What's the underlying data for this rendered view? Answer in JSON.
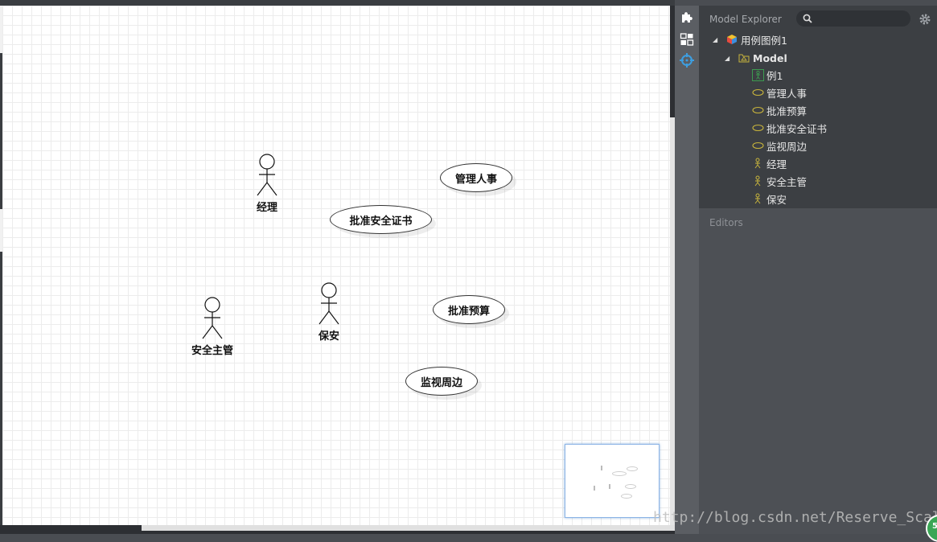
{
  "diagram": {
    "actors": [
      {
        "id": "actor-jingli",
        "label": "经理"
      },
      {
        "id": "actor-anquanzhuguan",
        "label": "安全主管"
      },
      {
        "id": "actor-baoan",
        "label": "保安"
      }
    ],
    "usecases": [
      {
        "id": "usecase-guanlirenshi",
        "label": "管理人事"
      },
      {
        "id": "usecase-pizhunanquanzhengshu",
        "label": "批准安全证书"
      },
      {
        "id": "usecase-pizhunyusuan",
        "label": "批准预算"
      },
      {
        "id": "usecase-jianshizhoubian",
        "label": "监视周边"
      }
    ]
  },
  "toolbar": {
    "icons": [
      "puzzle-icon",
      "layout-icon",
      "crosshair-icon"
    ],
    "accent": "#3d9ee0"
  },
  "explorer": {
    "title": "Model Explorer",
    "search_placeholder": "",
    "tree": {
      "project": "用例图例1",
      "model": "Model",
      "items": [
        {
          "type": "diagram",
          "label": "例1"
        },
        {
          "type": "usecase",
          "label": "管理人事"
        },
        {
          "type": "usecase",
          "label": "批准预算"
        },
        {
          "type": "usecase",
          "label": "批准安全证书"
        },
        {
          "type": "usecase",
          "label": "监视周边"
        },
        {
          "type": "actor",
          "label": "经理"
        },
        {
          "type": "actor",
          "label": "安全主管"
        },
        {
          "type": "actor",
          "label": "保安"
        }
      ]
    }
  },
  "editors": {
    "title": "Editors"
  },
  "watermark": "http://blog.csdn.net/Reserve_Scale",
  "colors": {
    "icon_yellow": "#c8b43c",
    "icon_green": "#3c9b50"
  }
}
